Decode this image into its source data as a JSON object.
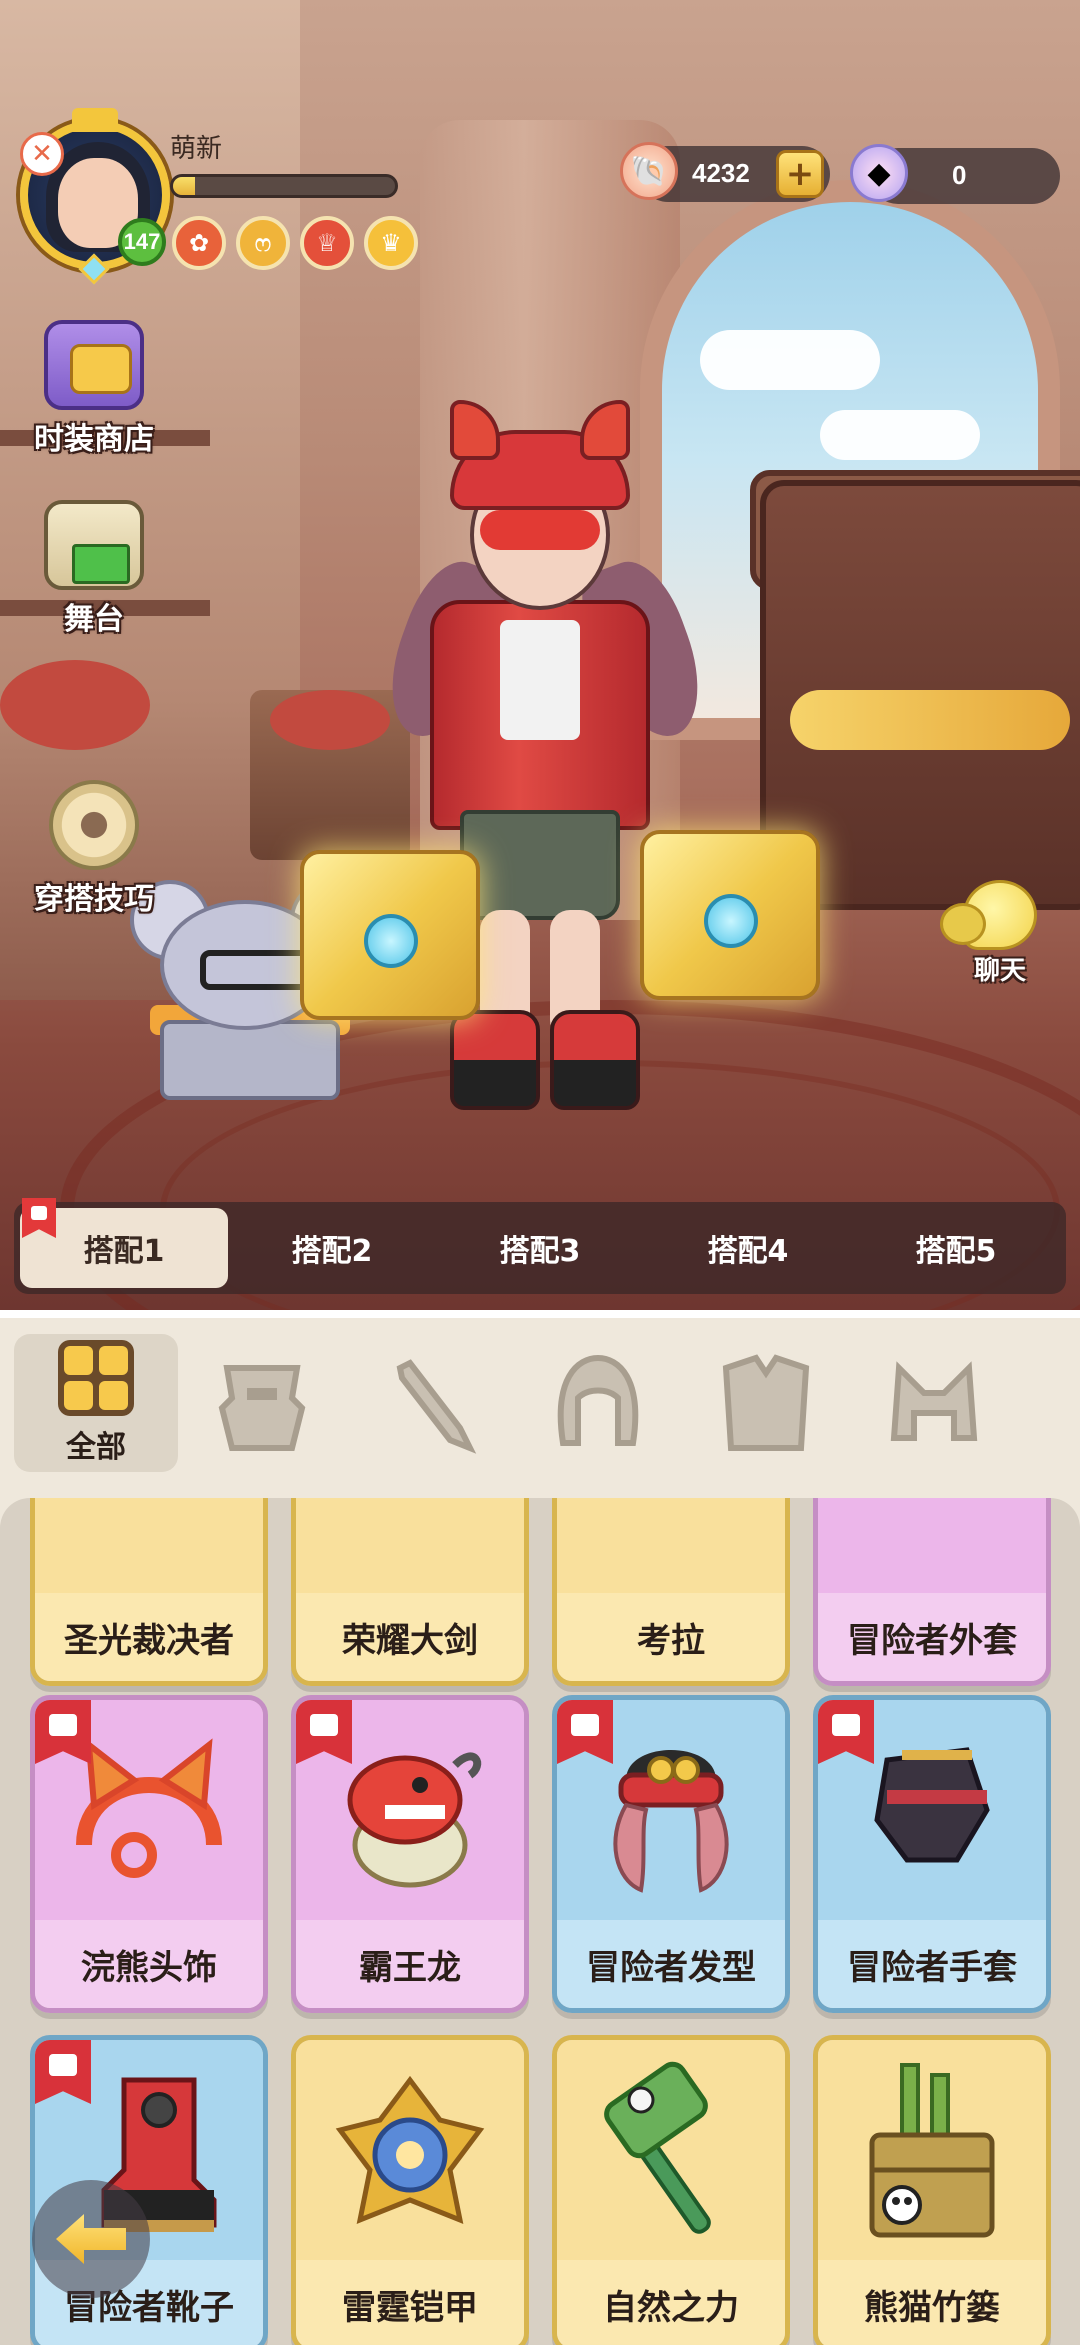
{
  "player": {
    "name": "萌新",
    "level": "147",
    "exp_fraction": 0.1,
    "badges": [
      {
        "icon": "flower-badge-icon",
        "glyph": "✿",
        "color": "#e8623a"
      },
      {
        "icon": "cat-badge-icon",
        "glyph": "ෆ",
        "color": "#f0b43a"
      },
      {
        "icon": "trophy-badge-icon",
        "glyph": "♕",
        "color": "#e4503a"
      },
      {
        "icon": "crown-badge-icon",
        "glyph": "♛",
        "color": "#f5c03a"
      }
    ]
  },
  "currency": {
    "shells": "4232",
    "plus": "+",
    "gems": "0"
  },
  "side_menu": {
    "shop": "时装商店",
    "stage": "舞台",
    "tips": "穿搭技巧"
  },
  "chat": "聊天",
  "outfits": [
    "搭配1",
    "搭配2",
    "搭配3",
    "搭配4",
    "搭配5"
  ],
  "categories": {
    "all_label": "全部",
    "icons": [
      "outfit-set-icon",
      "weapon-icon",
      "hair-icon",
      "top-icon",
      "headwear-icon"
    ]
  },
  "items": [
    {
      "name": "圣光裁决者",
      "color": "yellow",
      "flag": false
    },
    {
      "name": "荣耀大剑",
      "color": "yellow",
      "flag": false
    },
    {
      "name": "考拉",
      "color": "yellow",
      "flag": false
    },
    {
      "name": "冒险者外套",
      "color": "pink",
      "flag": false
    },
    {
      "name": "浣熊头饰",
      "color": "pink",
      "flag": true
    },
    {
      "name": "霸王龙",
      "color": "pink",
      "flag": true
    },
    {
      "name": "冒险者发型",
      "color": "blue",
      "flag": true
    },
    {
      "name": "冒险者手套",
      "color": "blue",
      "flag": true
    },
    {
      "name": "冒险者靴子",
      "color": "blue",
      "flag": true
    },
    {
      "name": "雷霆铠甲",
      "color": "yellow",
      "flag": false
    },
    {
      "name": "自然之力",
      "color": "yellow",
      "flag": false
    },
    {
      "name": "熊猫竹篓",
      "color": "yellow",
      "flag": false
    }
  ]
}
